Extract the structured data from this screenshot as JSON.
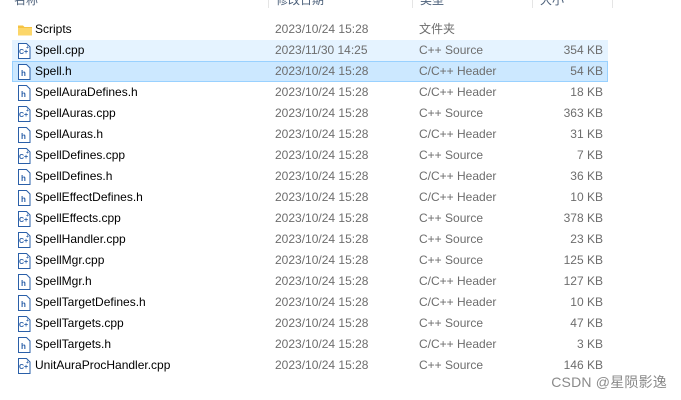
{
  "header": {
    "name": "名称",
    "date": "修改日期",
    "type": "类型",
    "size": "大小"
  },
  "files": [
    {
      "name": "Scripts",
      "date": "2023/10/24 15:28",
      "type": "文件夹",
      "size": "",
      "icon": "folder-icon",
      "state": ""
    },
    {
      "name": "Spell.cpp",
      "date": "2023/11/30 14:25",
      "type": "C++ Source",
      "size": "354 KB",
      "icon": "cpp-file-icon",
      "state": "hover"
    },
    {
      "name": "Spell.h",
      "date": "2023/10/24 15:28",
      "type": "C/C++ Header",
      "size": "54 KB",
      "icon": "header-file-icon",
      "state": "selected"
    },
    {
      "name": "SpellAuraDefines.h",
      "date": "2023/10/24 15:28",
      "type": "C/C++ Header",
      "size": "18 KB",
      "icon": "header-file-icon",
      "state": ""
    },
    {
      "name": "SpellAuras.cpp",
      "date": "2023/10/24 15:28",
      "type": "C++ Source",
      "size": "363 KB",
      "icon": "cpp-file-icon",
      "state": ""
    },
    {
      "name": "SpellAuras.h",
      "date": "2023/10/24 15:28",
      "type": "C/C++ Header",
      "size": "31 KB",
      "icon": "header-file-icon",
      "state": ""
    },
    {
      "name": "SpellDefines.cpp",
      "date": "2023/10/24 15:28",
      "type": "C++ Source",
      "size": "7 KB",
      "icon": "cpp-file-icon",
      "state": ""
    },
    {
      "name": "SpellDefines.h",
      "date": "2023/10/24 15:28",
      "type": "C/C++ Header",
      "size": "36 KB",
      "icon": "header-file-icon",
      "state": ""
    },
    {
      "name": "SpellEffectDefines.h",
      "date": "2023/10/24 15:28",
      "type": "C/C++ Header",
      "size": "10 KB",
      "icon": "header-file-icon",
      "state": ""
    },
    {
      "name": "SpellEffects.cpp",
      "date": "2023/10/24 15:28",
      "type": "C++ Source",
      "size": "378 KB",
      "icon": "cpp-file-icon",
      "state": ""
    },
    {
      "name": "SpellHandler.cpp",
      "date": "2023/10/24 15:28",
      "type": "C++ Source",
      "size": "23 KB",
      "icon": "cpp-file-icon",
      "state": ""
    },
    {
      "name": "SpellMgr.cpp",
      "date": "2023/10/24 15:28",
      "type": "C++ Source",
      "size": "125 KB",
      "icon": "cpp-file-icon",
      "state": ""
    },
    {
      "name": "SpellMgr.h",
      "date": "2023/10/24 15:28",
      "type": "C/C++ Header",
      "size": "127 KB",
      "icon": "header-file-icon",
      "state": ""
    },
    {
      "name": "SpellTargetDefines.h",
      "date": "2023/10/24 15:28",
      "type": "C/C++ Header",
      "size": "10 KB",
      "icon": "header-file-icon",
      "state": ""
    },
    {
      "name": "SpellTargets.cpp",
      "date": "2023/10/24 15:28",
      "type": "C++ Source",
      "size": "47 KB",
      "icon": "cpp-file-icon",
      "state": ""
    },
    {
      "name": "SpellTargets.h",
      "date": "2023/10/24 15:28",
      "type": "C/C++ Header",
      "size": "3 KB",
      "icon": "header-file-icon",
      "state": ""
    },
    {
      "name": "UnitAuraProcHandler.cpp",
      "date": "2023/10/24 15:28",
      "type": "C++ Source",
      "size": "146 KB",
      "icon": "cpp-file-icon",
      "state": ""
    }
  ],
  "watermark": "CSDN @星陨影逸",
  "colors": {
    "selected_bg": "#cce8ff",
    "selected_border": "#99d1ff",
    "hover_bg": "#e5f3ff",
    "folder": "#f5c343",
    "file_icon_blue": "#2a5fa8"
  }
}
